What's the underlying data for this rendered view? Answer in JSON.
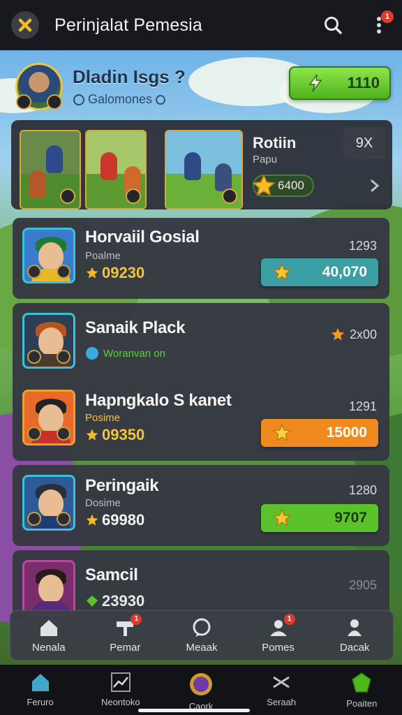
{
  "header": {
    "title": "Perinjalat Pemesia",
    "notification_badge": "1"
  },
  "profile": {
    "name": "Dladin Isgs ?",
    "subtitle": "Galomones",
    "coins": "1110"
  },
  "featured": {
    "title": "Rotiin",
    "subtitle": "Papu",
    "pill_value": "6400",
    "box_label": "9X"
  },
  "rows": [
    {
      "name": "Horvaiil Gosial",
      "sub": "Poalme",
      "score": "09230",
      "rank": "1293",
      "button": "40,070",
      "button_color": "#3c9fa3"
    },
    {
      "name": "Sanaik Plack",
      "sub": "Woranvan on",
      "score": "",
      "rank": "2x00",
      "button": "",
      "button_color": ""
    },
    {
      "name": "Hapngkalo S kanet",
      "sub": "Posime",
      "score": "09350",
      "rank": "1291",
      "button": "15000",
      "button_color": "#f0891e"
    },
    {
      "name": "Peringaik",
      "sub": "Dosime",
      "score": "69980",
      "rank": "1280",
      "button": "9707",
      "button_color": "#5cc22c"
    },
    {
      "name": "Samcil",
      "sub": "",
      "score": "23930",
      "rank": "2905",
      "button": "",
      "button_color": ""
    }
  ],
  "floatnav": [
    {
      "label": "Nenala",
      "icon": "home-icon",
      "badge": ""
    },
    {
      "label": "Pemar",
      "icon": "hammer-icon",
      "badge": "1"
    },
    {
      "label": "Meaak",
      "icon": "chat-icon",
      "badge": ""
    },
    {
      "label": "Pomes",
      "icon": "users-icon",
      "badge": "1"
    },
    {
      "label": "Dacak",
      "icon": "person-icon",
      "badge": ""
    }
  ],
  "tabbar": [
    {
      "label": "Feruro",
      "icon": "home-icon"
    },
    {
      "label": "Neontoko",
      "icon": "chart-icon"
    },
    {
      "label": "Caork",
      "icon": "potion-icon"
    },
    {
      "label": "Seraah",
      "icon": "shuffle-icon"
    },
    {
      "label": "Poaiten",
      "icon": "gem-icon"
    }
  ]
}
